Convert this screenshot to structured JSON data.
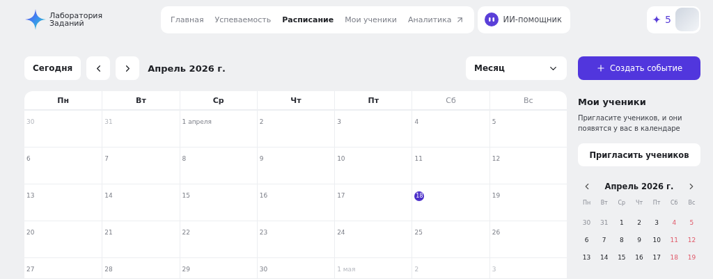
{
  "logo": {
    "line1": "Лаборатория",
    "line2": "Заданий"
  },
  "nav": [
    {
      "label": "Главная",
      "selected": false,
      "external": false
    },
    {
      "label": "Успеваемость",
      "selected": false,
      "external": false
    },
    {
      "label": "Расписание",
      "selected": true,
      "external": false
    },
    {
      "label": "Мои ученики",
      "selected": false,
      "external": false
    },
    {
      "label": "Аналитика",
      "selected": false,
      "external": true
    }
  ],
  "assistant": {
    "label": "ИИ-помощник"
  },
  "points": "5",
  "toolbar": {
    "today": "Сегодня",
    "period": "Апрель 2026 г.",
    "view": "Месяц",
    "create": "Создать событие"
  },
  "calendar": {
    "weekdays": [
      {
        "label": "Пн",
        "weekend": false
      },
      {
        "label": "Вт",
        "weekend": false
      },
      {
        "label": "Ср",
        "weekend": false
      },
      {
        "label": "Чт",
        "weekend": false
      },
      {
        "label": "Пт",
        "weekend": false
      },
      {
        "label": "Сб",
        "weekend": true
      },
      {
        "label": "Вс",
        "weekend": true
      }
    ],
    "weeks": [
      [
        {
          "label": "30",
          "muted": true,
          "selected": false
        },
        {
          "label": "31",
          "muted": true,
          "selected": false
        },
        {
          "label": "1 апреля",
          "muted": false,
          "selected": false
        },
        {
          "label": "2",
          "muted": false,
          "selected": false
        },
        {
          "label": "3",
          "muted": false,
          "selected": false
        },
        {
          "label": "4",
          "muted": false,
          "selected": false
        },
        {
          "label": "5",
          "muted": false,
          "selected": false
        }
      ],
      [
        {
          "label": "6",
          "muted": false,
          "selected": false
        },
        {
          "label": "7",
          "muted": false,
          "selected": false
        },
        {
          "label": "8",
          "muted": false,
          "selected": false
        },
        {
          "label": "9",
          "muted": false,
          "selected": false
        },
        {
          "label": "10",
          "muted": false,
          "selected": false
        },
        {
          "label": "11",
          "muted": false,
          "selected": false
        },
        {
          "label": "12",
          "muted": false,
          "selected": false
        }
      ],
      [
        {
          "label": "13",
          "muted": false,
          "selected": false
        },
        {
          "label": "14",
          "muted": false,
          "selected": false
        },
        {
          "label": "15",
          "muted": false,
          "selected": false
        },
        {
          "label": "16",
          "muted": false,
          "selected": false
        },
        {
          "label": "17",
          "muted": false,
          "selected": false
        },
        {
          "label": "18",
          "muted": false,
          "selected": true
        },
        {
          "label": "19",
          "muted": false,
          "selected": false
        }
      ],
      [
        {
          "label": "20",
          "muted": false,
          "selected": false
        },
        {
          "label": "21",
          "muted": false,
          "selected": false
        },
        {
          "label": "22",
          "muted": false,
          "selected": false
        },
        {
          "label": "23",
          "muted": false,
          "selected": false
        },
        {
          "label": "24",
          "muted": false,
          "selected": false
        },
        {
          "label": "25",
          "muted": false,
          "selected": false
        },
        {
          "label": "26",
          "muted": false,
          "selected": false
        }
      ],
      [
        {
          "label": "27",
          "muted": false,
          "selected": false
        },
        {
          "label": "28",
          "muted": false,
          "selected": false
        },
        {
          "label": "29",
          "muted": false,
          "selected": false
        },
        {
          "label": "30",
          "muted": false,
          "selected": false
        },
        {
          "label": "1 мая",
          "muted": true,
          "selected": false
        },
        {
          "label": "2",
          "muted": true,
          "selected": false
        },
        {
          "label": "3",
          "muted": true,
          "selected": false
        }
      ]
    ]
  },
  "students": {
    "title": "Мои ученики",
    "text": "Пригласите учеников, и они появятся у вас в календаре",
    "invite": "Пригласить учеников"
  },
  "mini_calendar": {
    "title": "Апрель 2026 г.",
    "weekdays": [
      "Пн",
      "Вт",
      "Ср",
      "Чт",
      "Пт",
      "Сб",
      "Вс"
    ],
    "weeks": [
      [
        {
          "label": "30",
          "muted": true,
          "weekend": false
        },
        {
          "label": "31",
          "muted": true,
          "weekend": false
        },
        {
          "label": "1",
          "muted": false,
          "weekend": false
        },
        {
          "label": "2",
          "muted": false,
          "weekend": false
        },
        {
          "label": "3",
          "muted": false,
          "weekend": false
        },
        {
          "label": "4",
          "muted": false,
          "weekend": true
        },
        {
          "label": "5",
          "muted": false,
          "weekend": true
        }
      ],
      [
        {
          "label": "6",
          "muted": false,
          "weekend": false
        },
        {
          "label": "7",
          "muted": false,
          "weekend": false
        },
        {
          "label": "8",
          "muted": false,
          "weekend": false
        },
        {
          "label": "9",
          "muted": false,
          "weekend": false
        },
        {
          "label": "10",
          "muted": false,
          "weekend": false
        },
        {
          "label": "11",
          "muted": false,
          "weekend": true
        },
        {
          "label": "12",
          "muted": false,
          "weekend": true
        }
      ],
      [
        {
          "label": "13",
          "muted": false,
          "weekend": false
        },
        {
          "label": "14",
          "muted": false,
          "weekend": false
        },
        {
          "label": "15",
          "muted": false,
          "weekend": false
        },
        {
          "label": "16",
          "muted": false,
          "weekend": false
        },
        {
          "label": "17",
          "muted": false,
          "weekend": false
        },
        {
          "label": "18",
          "muted": false,
          "weekend": true
        },
        {
          "label": "19",
          "muted": false,
          "weekend": true
        }
      ]
    ]
  }
}
